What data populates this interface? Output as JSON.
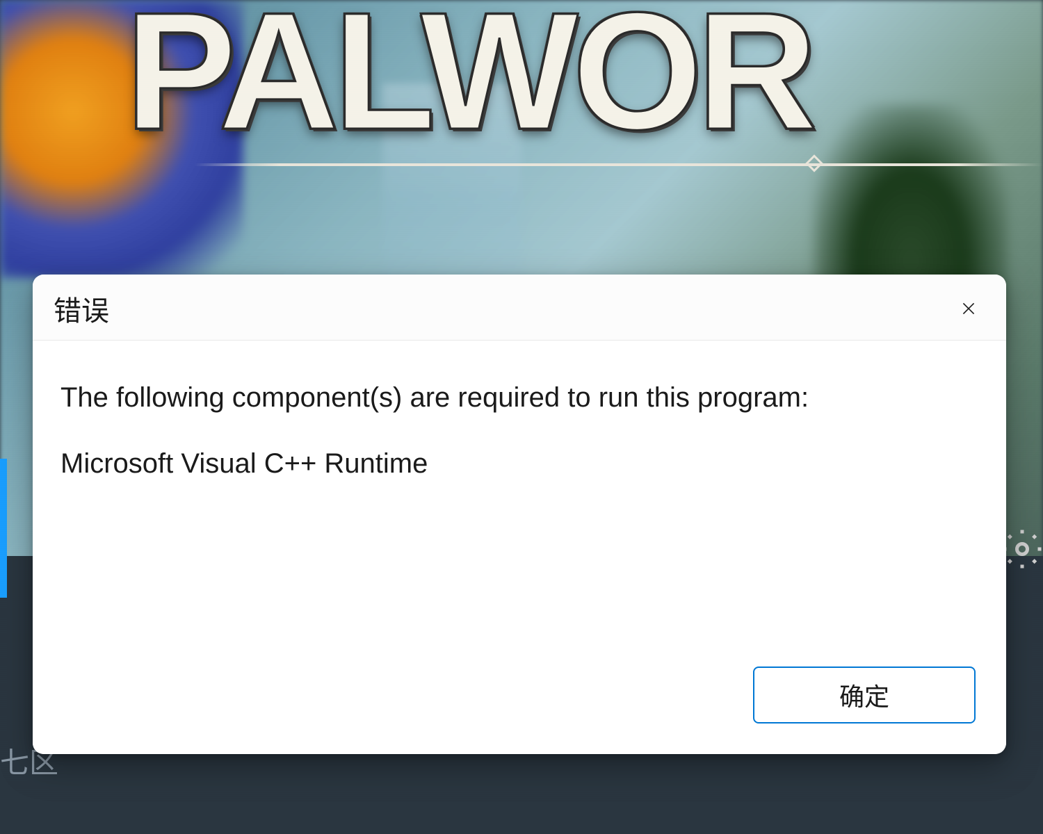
{
  "background": {
    "game_title": "PALWOR",
    "steam_corner_text": "七区"
  },
  "dialog": {
    "title": "错误",
    "message_heading": "The following component(s) are required to run this program:",
    "required_component": "Microsoft Visual C++ Runtime",
    "ok_button_label": "确定"
  },
  "icons": {
    "close": "close-icon",
    "settings": "gear-icon"
  }
}
